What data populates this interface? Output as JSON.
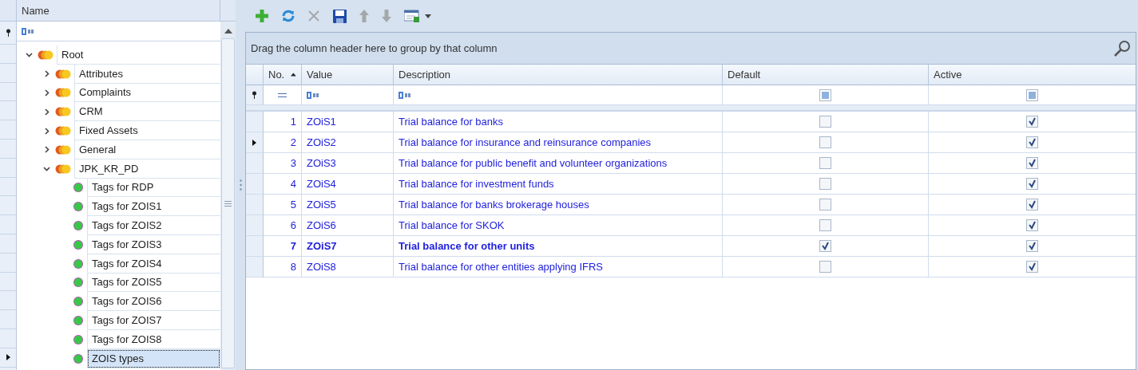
{
  "tree": {
    "column": "Name",
    "nodes": [
      {
        "label": "Root",
        "kind": "folder",
        "expanded": true,
        "selected": false,
        "children": [
          {
            "label": "Attributes",
            "kind": "folder",
            "expanded": false,
            "selected": false
          },
          {
            "label": "Complaints",
            "kind": "folder",
            "expanded": false,
            "selected": false
          },
          {
            "label": "CRM",
            "kind": "folder",
            "expanded": false,
            "selected": false
          },
          {
            "label": "Fixed Assets",
            "kind": "folder",
            "expanded": false,
            "selected": false
          },
          {
            "label": "General",
            "kind": "folder",
            "expanded": false,
            "selected": false
          },
          {
            "label": "JPK_KR_PD",
            "kind": "folder",
            "expanded": true,
            "selected": false,
            "children": [
              {
                "label": "Tags for RDP",
                "kind": "leaf",
                "selected": false
              },
              {
                "label": "Tags for ZOIS1",
                "kind": "leaf",
                "selected": false
              },
              {
                "label": "Tags for ZOIS2",
                "kind": "leaf",
                "selected": false
              },
              {
                "label": "Tags for ZOIS3",
                "kind": "leaf",
                "selected": false
              },
              {
                "label": "Tags for ZOIS4",
                "kind": "leaf",
                "selected": false
              },
              {
                "label": "Tags for ZOIS5",
                "kind": "leaf",
                "selected": false
              },
              {
                "label": "Tags for ZOIS6",
                "kind": "leaf",
                "selected": false
              },
              {
                "label": "Tags for ZOIS7",
                "kind": "leaf",
                "selected": false
              },
              {
                "label": "Tags for ZOIS8",
                "kind": "leaf",
                "selected": false
              },
              {
                "label": "ZOIS types",
                "kind": "leaf",
                "selected": true
              }
            ]
          }
        ]
      }
    ]
  },
  "toolbar": [
    {
      "kind": "add",
      "disabled": false
    },
    {
      "kind": "refresh",
      "disabled": false
    },
    {
      "kind": "delete",
      "disabled": true
    },
    {
      "kind": "save",
      "disabled": false
    },
    {
      "kind": "up",
      "disabled": true
    },
    {
      "kind": "down",
      "disabled": true
    },
    {
      "kind": "export",
      "disabled": false
    }
  ],
  "grid": {
    "group_hint": "Drag the column header here to group by that column",
    "columns": [
      "No.",
      "Value",
      "Description",
      "Default",
      "Active"
    ],
    "filters": [
      {
        "kind": "equals"
      },
      {
        "kind": "text"
      },
      {
        "kind": "text"
      },
      {
        "kind": "check",
        "indeterminate": true
      },
      {
        "kind": "check",
        "indeterminate": true
      }
    ],
    "rows": [
      {
        "no": "1",
        "value": "ZOiS1",
        "description": "Trial balance for banks",
        "default": false,
        "active": true,
        "selected": false
      },
      {
        "no": "2",
        "value": "ZOiS2",
        "description": "Trial balance for insurance and reinsurance companies",
        "default": false,
        "active": true,
        "selected": true
      },
      {
        "no": "3",
        "value": "ZOiS3",
        "description": "Trial balance for public benefit and volunteer organizations",
        "default": false,
        "active": true,
        "selected": false
      },
      {
        "no": "4",
        "value": "ZOiS4",
        "description": "Trial balance for investment funds",
        "default": false,
        "active": true,
        "selected": false
      },
      {
        "no": "5",
        "value": "ZOiS5",
        "description": "Trial balance for banks brokerage houses",
        "default": false,
        "active": true,
        "selected": false
      },
      {
        "no": "6",
        "value": "ZOiS6",
        "description": "Trial balance for SKOK",
        "default": false,
        "active": true,
        "selected": false
      },
      {
        "no": "7",
        "value": "ZOiS7",
        "description": "Trial balance for other units",
        "default": true,
        "active": true,
        "selected": false
      },
      {
        "no": "8",
        "value": "ZOiS8",
        "description": "Trial balance for other entities applying IFRS",
        "default": false,
        "active": true,
        "selected": false
      }
    ]
  }
}
